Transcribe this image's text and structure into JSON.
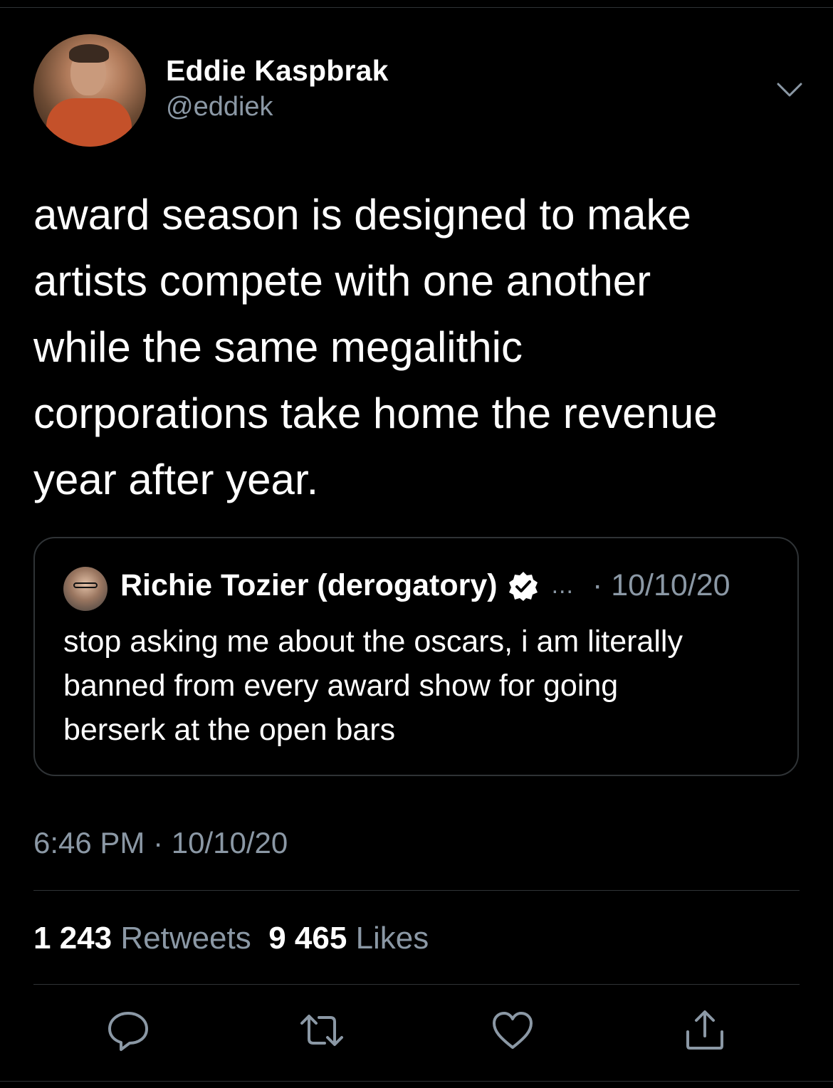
{
  "author": {
    "display_name": "Eddie Kaspbrak",
    "handle": "@eddiek"
  },
  "tweet": {
    "text_lines": [
      "award season is designed to make",
      "artists compete with one another",
      "while the same megalithic",
      "corporations take home the revenue",
      "year after year."
    ],
    "timestamp": "6:46 PM · 10/10/20"
  },
  "quoted_tweet": {
    "display_name": "Richie Tozier (derogatory)",
    "verified": true,
    "ellipsis": "...",
    "date": "· 10/10/20",
    "text_lines": [
      "stop asking me about the oscars, i am literally",
      "banned from every award show for going",
      "berserk at the open bars"
    ]
  },
  "stats": {
    "retweets_count": "1 243",
    "retweets_label": "Retweets",
    "likes_count": "9 465",
    "likes_label": "Likes"
  },
  "icons": {
    "menu": "chevron-down-icon",
    "reply": "reply-icon",
    "retweet": "retweet-icon",
    "like": "heart-icon",
    "share": "share-icon",
    "verified": "verified-badge-icon"
  },
  "colors": {
    "background": "#000000",
    "text": "#ffffff",
    "secondary": "#8b98a5",
    "border": "#2f3336"
  }
}
